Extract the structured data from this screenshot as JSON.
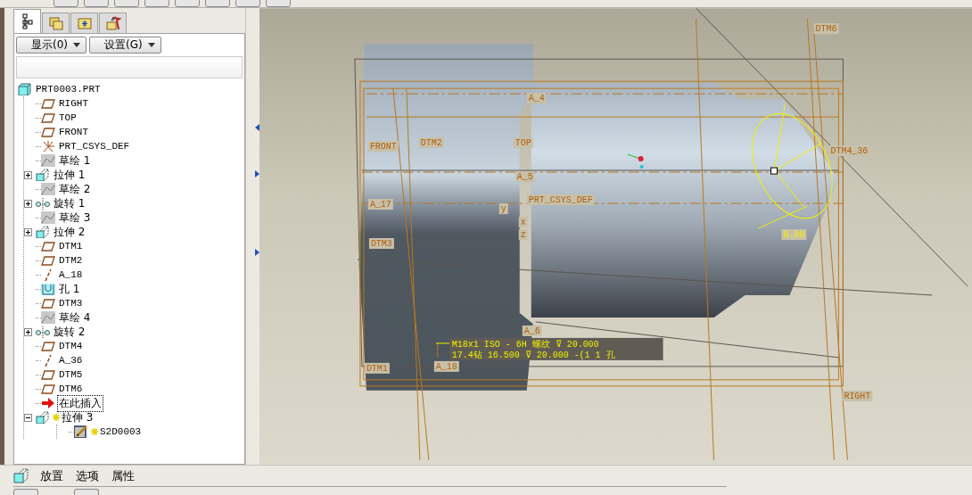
{
  "navigator": {
    "tabs": [
      {
        "kind": "tree",
        "selected": true
      },
      {
        "kind": "folders",
        "selected": false
      },
      {
        "kind": "favorites",
        "selected": false
      },
      {
        "kind": "tools",
        "selected": false
      }
    ],
    "buttons": [
      {
        "label": "显示(0)"
      },
      {
        "label": "设置(G)"
      }
    ],
    "tree": [
      {
        "label": "PRT0003.PRT",
        "kind": "part",
        "selected": false,
        "children": [
          {
            "label": "RIGHT",
            "kind": "plane",
            "selected": false
          },
          {
            "label": "TOP",
            "kind": "plane",
            "selected": false
          },
          {
            "label": "FRONT",
            "kind": "plane",
            "selected": false
          },
          {
            "label": "PRT_CSYS_DEF",
            "kind": "csys",
            "selected": false
          },
          {
            "label": "草绘 1",
            "kind": "sketch",
            "selected": false
          },
          {
            "label": "拉伸 1",
            "kind": "extrude",
            "selected": false,
            "expanded": false
          },
          {
            "label": "草绘 2",
            "kind": "sketch",
            "selected": false
          },
          {
            "label": "旋转 1",
            "kind": "revolve",
            "selected": false,
            "expanded": false
          },
          {
            "label": "草绘 3",
            "kind": "sketch",
            "selected": false
          },
          {
            "label": "拉伸 2",
            "kind": "extrude",
            "selected": false,
            "expanded": false
          },
          {
            "label": "DTM1",
            "kind": "plane",
            "selected": false
          },
          {
            "label": "DTM2",
            "kind": "plane",
            "selected": false
          },
          {
            "label": "A_18",
            "kind": "axis",
            "selected": false
          },
          {
            "label": "孔 1",
            "kind": "hole",
            "selected": false
          },
          {
            "label": "DTM3",
            "kind": "plane",
            "selected": false
          },
          {
            "label": "草绘 4",
            "kind": "sketch",
            "selected": false
          },
          {
            "label": "旋转 2",
            "kind": "revolve",
            "selected": false,
            "expanded": false
          },
          {
            "label": "DTM4",
            "kind": "plane",
            "selected": false
          },
          {
            "label": "A_36",
            "kind": "axis",
            "selected": false
          },
          {
            "label": "DTM5",
            "kind": "plane",
            "selected": false
          },
          {
            "label": "DTM6",
            "kind": "plane",
            "selected": false
          },
          {
            "label": "在此插入",
            "kind": "insert",
            "selected": true
          },
          {
            "label": "拉伸 3",
            "kind": "extrude",
            "selected": false,
            "new": true,
            "expanded": true,
            "children": [
              {
                "label": "S2D0003",
                "kind": "section",
                "selected": false,
                "new": true
              }
            ]
          }
        ]
      }
    ]
  },
  "viewport": {
    "labels": [
      {
        "text": "DTM6",
        "kind": "datum"
      },
      {
        "text": "A_4",
        "kind": "datum"
      },
      {
        "text": "FRONT",
        "kind": "datum"
      },
      {
        "text": "DTM2",
        "kind": "datum"
      },
      {
        "text": "TOP",
        "kind": "datum"
      },
      {
        "text": "DTM4_36",
        "kind": "datum"
      },
      {
        "text": "A_5",
        "kind": "datum"
      },
      {
        "text": "A_17",
        "kind": "datum"
      },
      {
        "text": "PRT_CSYS_DEF",
        "kind": "datum"
      },
      {
        "text": "y",
        "kind": "datum"
      },
      {
        "text": "x",
        "kind": "datum"
      },
      {
        "text": "z",
        "kind": "datum"
      },
      {
        "text": "8.00",
        "kind": "dimension"
      },
      {
        "text": "DTM3",
        "kind": "datum"
      },
      {
        "text": "A_6",
        "kind": "datum"
      },
      {
        "text": "DTM1",
        "kind": "datum"
      },
      {
        "text": "A_18",
        "kind": "datum"
      },
      {
        "text": "RIGHT",
        "kind": "datum"
      }
    ],
    "hole_note": [
      "M18x1 ISO - 6H 螺纹 ⊽ 20.000",
      "17.4钻 16.500 ⊽ 20.000 -(1 1 孔"
    ]
  },
  "dashboard": {
    "tabs": [
      {
        "label": "放置"
      },
      {
        "label": "选项"
      },
      {
        "label": "属性"
      }
    ]
  }
}
